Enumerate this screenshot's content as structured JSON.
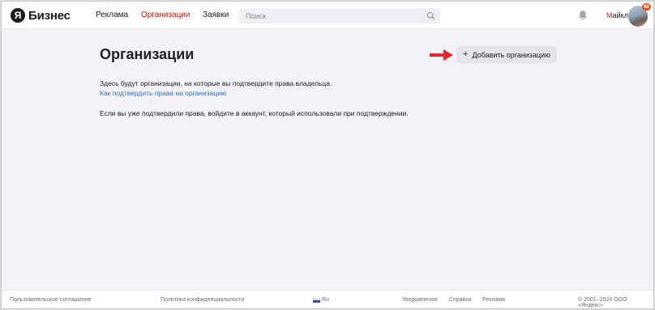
{
  "header": {
    "logo_mark": "Я",
    "logo_text": "Бизнес",
    "nav": [
      {
        "label": "Реклама",
        "active": false
      },
      {
        "label": "Организации",
        "active": true
      },
      {
        "label": "Заявки",
        "active": false
      }
    ],
    "search_placeholder": "Поиск",
    "user_first": "М",
    "user_rest": "айкл",
    "notification_count": "66"
  },
  "main": {
    "title": "Организации",
    "add_button_label": "Добавить организацию",
    "info_text": "Здесь будут организации, на которые вы подтвердите права владельца.",
    "help_link": "Как подтвердить права на организацию",
    "login_hint": "Если вы уже подтвердили права, войдите в аккаунт, который использовали при подтверждении."
  },
  "footer": {
    "user_agreement": "Пользовательское соглашение",
    "privacy_policy": "Политика конфиденциальности",
    "language": "Ru",
    "notifications": "Уведомления",
    "help": "Справка",
    "ads": "Реклама",
    "copyright": "© 2001–2024 ООО «Яндекс»"
  },
  "colors": {
    "accent_red": "#c4180f",
    "link_blue": "#2676c0",
    "background": "#f2f2f7"
  },
  "icons": [
    "search-icon",
    "bell-icon",
    "plus-icon",
    "arrow-right-icon",
    "russia-flag-icon"
  ]
}
